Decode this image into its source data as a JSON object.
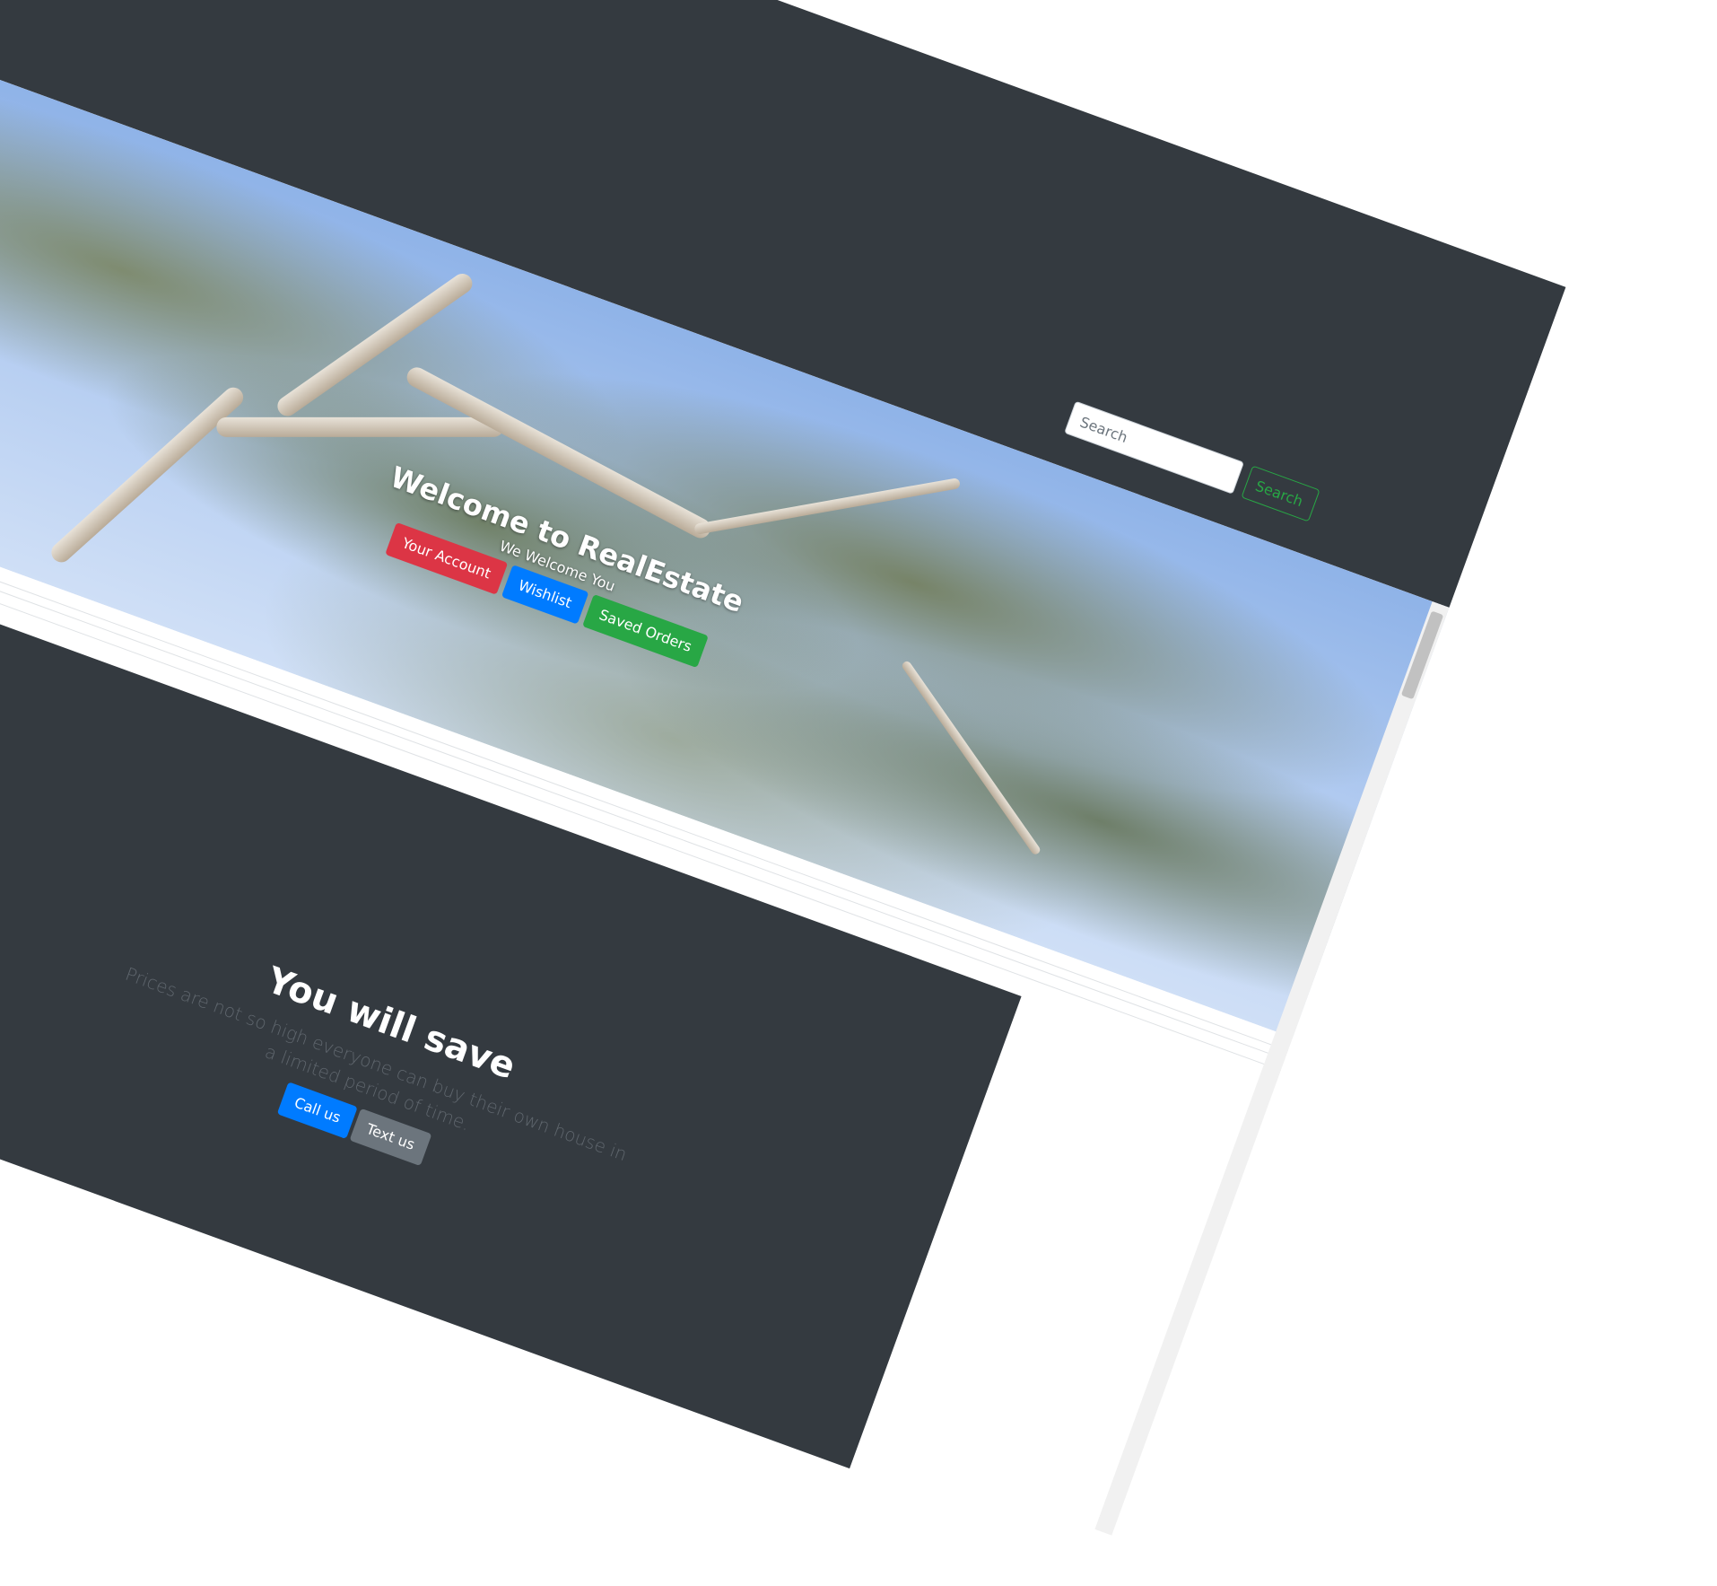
{
  "navbar": {
    "search": {
      "placeholder": "Search",
      "button_label": "Search"
    }
  },
  "carousel": {
    "title": "Welcome to RealEstate",
    "subtitle": "We Welcome You",
    "buttons": [
      "Your Account",
      "Wishlist",
      "Saved Orders"
    ]
  },
  "jumbotron": {
    "title": "You will save",
    "lead": "Prices are not so high everyone can buy their own house in a limited period of time.",
    "buttons": [
      "Call us",
      "Text us"
    ]
  },
  "colors": {
    "navbar_bg": "#343a40",
    "danger": "#dc3545",
    "primary": "#007bff",
    "success": "#28a745",
    "secondary": "#6c757d"
  }
}
